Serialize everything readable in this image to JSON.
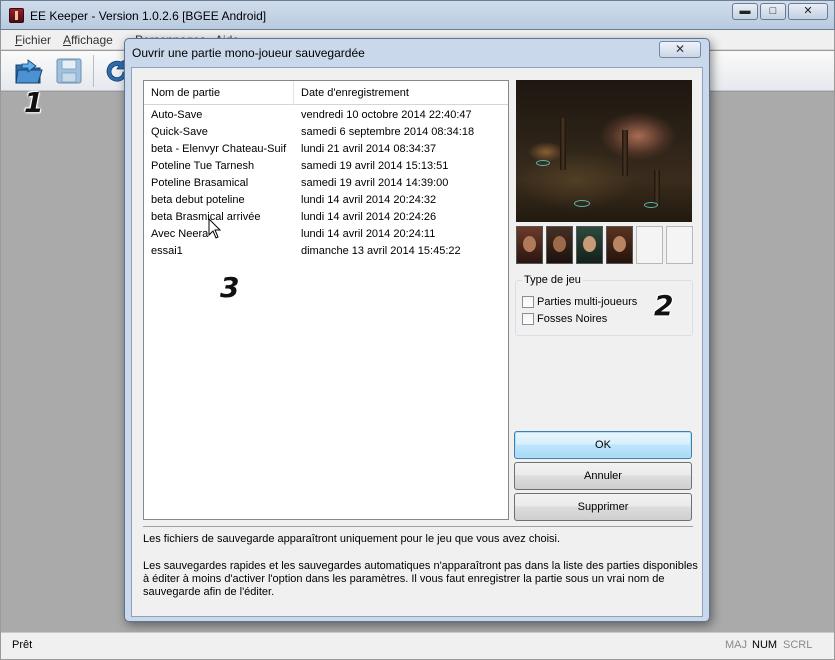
{
  "main_window": {
    "title": "EE Keeper - Version 1.0.2.6 [BGEE Android]",
    "controls": {
      "minimize": "▬",
      "maximize": "□",
      "close": "✕"
    }
  },
  "menu": {
    "items": [
      {
        "label": "Fichier"
      },
      {
        "label": "Affichage"
      },
      {
        "label": "Personnages"
      },
      {
        "label": "Aide"
      }
    ]
  },
  "toolbar": {
    "icons": [
      "open-folder-icon",
      "save-floppy-icon",
      "refresh-icon"
    ]
  },
  "annotations": {
    "one": "1",
    "two": "2",
    "three": "3"
  },
  "dialog": {
    "title": "Ouvrir une partie mono-joueur sauvegardée",
    "close_glyph": "✕",
    "list": {
      "columns": [
        "Nom de partie",
        "Date d'enregistrement"
      ],
      "rows": [
        {
          "name": "Auto-Save",
          "date": "vendredi 10 octobre 2014 22:40:47"
        },
        {
          "name": "Quick-Save",
          "date": "samedi 6 septembre 2014 08:34:18"
        },
        {
          "name": "beta - Elenvyr Chateau-Suif",
          "date": "lundi 21 avril 2014 08:34:37"
        },
        {
          "name": "Poteline Tue Tarnesh",
          "date": "samedi 19 avril 2014 15:13:51"
        },
        {
          "name": "Poteline Brasamical",
          "date": "samedi 19 avril 2014 14:39:00"
        },
        {
          "name": "beta debut poteline",
          "date": "lundi 14 avril 2014 20:24:32"
        },
        {
          "name": "beta Brasmical arrivée",
          "date": "lundi 14 avril 2014 20:24:26"
        },
        {
          "name": "Avec Neera",
          "date": "lundi 14 avril 2014 20:24:11"
        },
        {
          "name": "essai1",
          "date": "dimanche 13 avril 2014 15:45:22"
        }
      ]
    },
    "game_type": {
      "legend": "Type de jeu",
      "options": [
        {
          "label": "Parties multi-joueurs",
          "checked": false
        },
        {
          "label": "Fosses Noires",
          "checked": false
        }
      ]
    },
    "buttons": {
      "ok": "OK",
      "cancel": "Annuler",
      "delete": "Supprimer"
    },
    "info": {
      "line1": "Les fichiers de sauvegarde apparaîtront uniquement pour le jeu que vous avez choisi.",
      "line2": "Les sauvegardes rapides et les sauvegardes automatiques n'apparaîtront pas dans la liste des parties disponibles à éditer à moins d'activer l'option dans les paramètres. Il vous faut enregistrer la partie sous un vrai nom de sauvegarde afin de l'éditer."
    }
  },
  "statusbar": {
    "text": "Prêt",
    "indicators": [
      {
        "label": "MAJ",
        "active": false
      },
      {
        "label": "NUM",
        "active": true
      },
      {
        "label": "SCRL",
        "active": false
      }
    ]
  },
  "colors": {
    "dialog_frame": "#c9d8ea",
    "default_button": "#bee6fd",
    "workspace": "#aaaaaa"
  }
}
